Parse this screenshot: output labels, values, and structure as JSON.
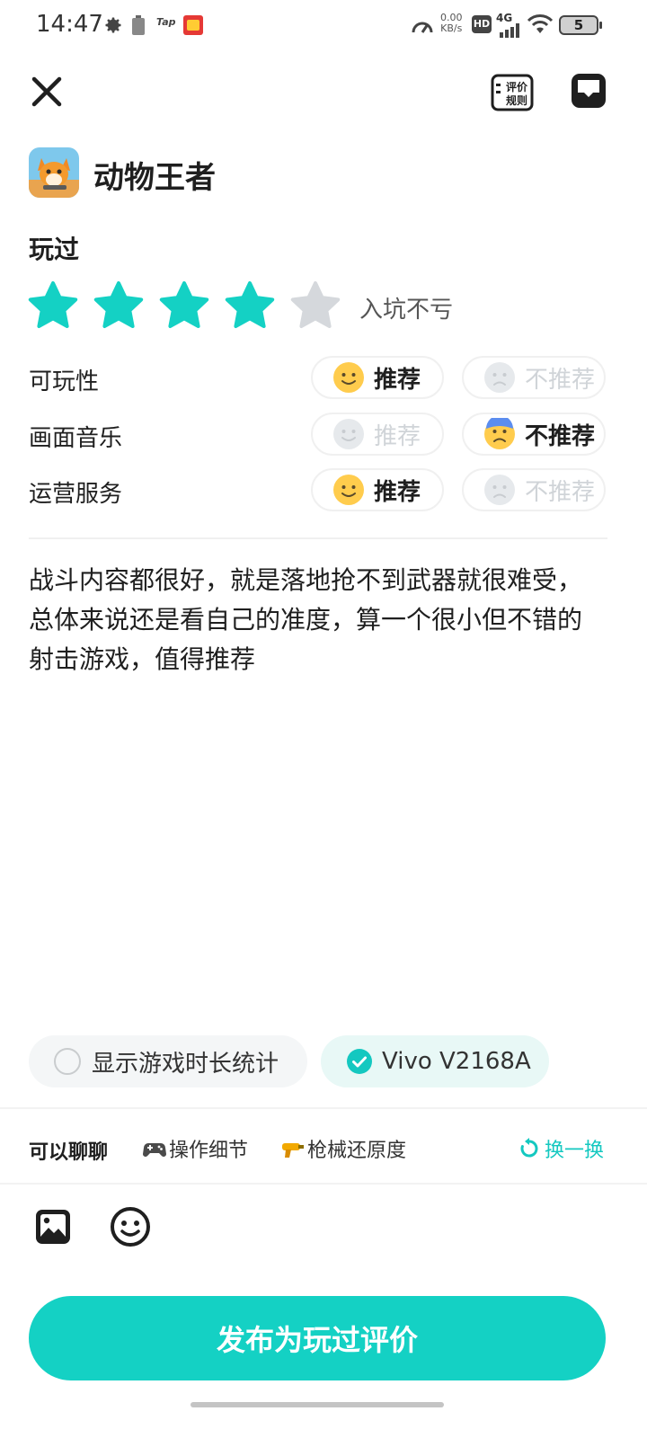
{
  "status_bar": {
    "time": "14:47",
    "net_speed_value": "0.00",
    "net_speed_unit": "KB/s",
    "hd_label": "HD",
    "lte_label": "4G",
    "tap_label": "Tap",
    "battery_level": "5",
    "icons": [
      "gear-icon",
      "battery-small-icon",
      "tap-app-icon",
      "app-notification-icon",
      "speedometer-icon",
      "signal-icon",
      "wifi-icon"
    ]
  },
  "header": {
    "close_icon": "close-icon",
    "rules_icon_text": "评价规则",
    "message_icon": "chat-bubble-icon"
  },
  "game": {
    "title": "动物王者"
  },
  "rating": {
    "section_label": "玩过",
    "stars_value": 4,
    "stars_max": 5,
    "caption": "入坑不亏",
    "star_color_on": "#14d1c4",
    "star_color_off": "#d5d8dc"
  },
  "criteria": [
    {
      "name": "可玩性",
      "recommend_label": "推荐",
      "not_recommend_label": "不推荐",
      "selected": "recommend"
    },
    {
      "name": "画面音乐",
      "recommend_label": "推荐",
      "not_recommend_label": "不推荐",
      "selected": "not_recommend"
    },
    {
      "name": "运营服务",
      "recommend_label": "推荐",
      "not_recommend_label": "不推荐",
      "selected": "recommend"
    }
  ],
  "review_text": "战斗内容都很好，就是落地抢不到武器就很难受，总体来说还是看自己的准度，算一个很小但不错的射击游戏，值得推荐",
  "options": {
    "playtime_label": "显示游戏时长统计",
    "playtime_checked": false,
    "device_label": "Vivo V2168A",
    "device_checked": true
  },
  "topics": {
    "label": "可以聊聊",
    "items": [
      {
        "text": "操作细节",
        "icon": "gamepad-icon"
      },
      {
        "text": "枪械还原度",
        "icon": "water-gun-icon"
      }
    ],
    "refresh_label": "换一换"
  },
  "toolbar": {
    "image_icon": "image-icon",
    "emoji_icon": "emoji-icon"
  },
  "publish_label": "发布为玩过评价",
  "colors": {
    "accent": "#14d1c4",
    "accent_text": "#14c8c0",
    "disabled_text": "#d0d4d8"
  }
}
